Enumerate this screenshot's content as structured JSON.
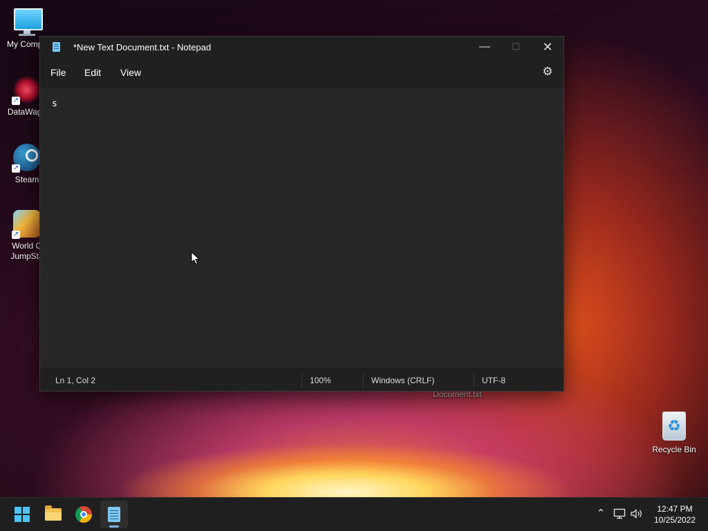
{
  "desktop": {
    "icons": [
      {
        "label": "My Compu",
        "icon": "computer-icon"
      },
      {
        "label": "DataWago",
        "icon": "datawagon-icon"
      },
      {
        "label": "Steam",
        "icon": "steam-icon"
      },
      {
        "label": "World O JumpSta",
        "icon": "game-icon"
      }
    ],
    "recycle_bin": {
      "label": "Recycle Bin",
      "icon": "recycle-bin-icon"
    },
    "hover_label": "Document.txt"
  },
  "notepad": {
    "title": "*New Text Document.txt - Notepad",
    "menu": {
      "file": "File",
      "edit": "Edit",
      "view": "View"
    },
    "content": "s",
    "status": {
      "position": "Ln 1, Col 2",
      "zoom": "100%",
      "line_ending": "Windows (CRLF)",
      "encoding": "UTF-8"
    },
    "icons": [
      "notepad-icon",
      "minimize-icon",
      "maximize-icon",
      "close-icon",
      "settings-gear-icon"
    ]
  },
  "taskbar": {
    "apps": [
      "start-icon",
      "file-explorer-icon",
      "chrome-icon",
      "notepad-icon"
    ],
    "active_app": "notepad",
    "tray_icons": [
      "chevron-up-icon",
      "network-icon",
      "volume-icon"
    ],
    "clock": {
      "time": "12:47 PM",
      "date": "10/25/2022"
    }
  },
  "colors": {
    "window_bg": "#202020",
    "editor_bg": "#272727",
    "taskbar_bg": "#1f1f1f",
    "accent": "#4cc2ff"
  }
}
